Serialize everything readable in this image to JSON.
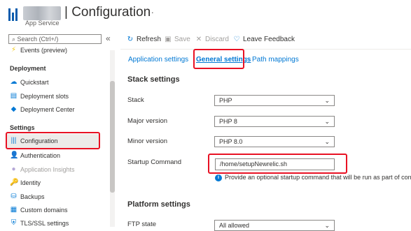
{
  "header": {
    "title": "| Configuration",
    "subtitle": "App Service",
    "more": "···"
  },
  "sidebar": {
    "search_placeholder": "Search (Ctrl+/)",
    "collapse": "«",
    "items": [
      {
        "label": "Events (preview)",
        "icon": "lightning-icon",
        "section": null
      },
      {
        "label": "Deployment",
        "header": true
      },
      {
        "label": "Quickstart",
        "icon": "cloud-icon"
      },
      {
        "label": "Deployment slots",
        "icon": "slots-icon"
      },
      {
        "label": "Deployment Center",
        "icon": "cube-icon"
      },
      {
        "label": "Settings",
        "header": true
      },
      {
        "label": "Configuration",
        "icon": "configuration-icon",
        "selected": true
      },
      {
        "label": "Authentication",
        "icon": "person-icon"
      },
      {
        "label": "Application Insights",
        "icon": "lightbulb-icon",
        "disabled": true
      },
      {
        "label": "Identity",
        "icon": "key-icon"
      },
      {
        "label": "Backups",
        "icon": "backup-icon"
      },
      {
        "label": "Custom domains",
        "icon": "domain-icon"
      },
      {
        "label": "TLS/SSL settings",
        "icon": "shield-icon"
      }
    ]
  },
  "toolbar": {
    "refresh": "Refresh",
    "save": "Save",
    "discard": "Discard",
    "feedback": "Leave Feedback"
  },
  "tabs": {
    "application": "Application settings",
    "general": "General settings",
    "path": "Path mappings"
  },
  "stack_settings": {
    "title": "Stack settings",
    "stack_label": "Stack",
    "stack_value": "PHP",
    "major_label": "Major version",
    "major_value": "PHP 8",
    "minor_label": "Minor version",
    "minor_value": "PHP 8.0",
    "startup_label": "Startup Command",
    "startup_value": "/home/setupNewrelic.sh",
    "startup_info": "Provide an optional startup command that will be run as part of conta"
  },
  "platform_settings": {
    "title": "Platform settings",
    "ftp_label": "FTP state",
    "ftp_value": "All allowed"
  },
  "colors": {
    "accent": "#0078d4",
    "highlight": "#e81123"
  }
}
